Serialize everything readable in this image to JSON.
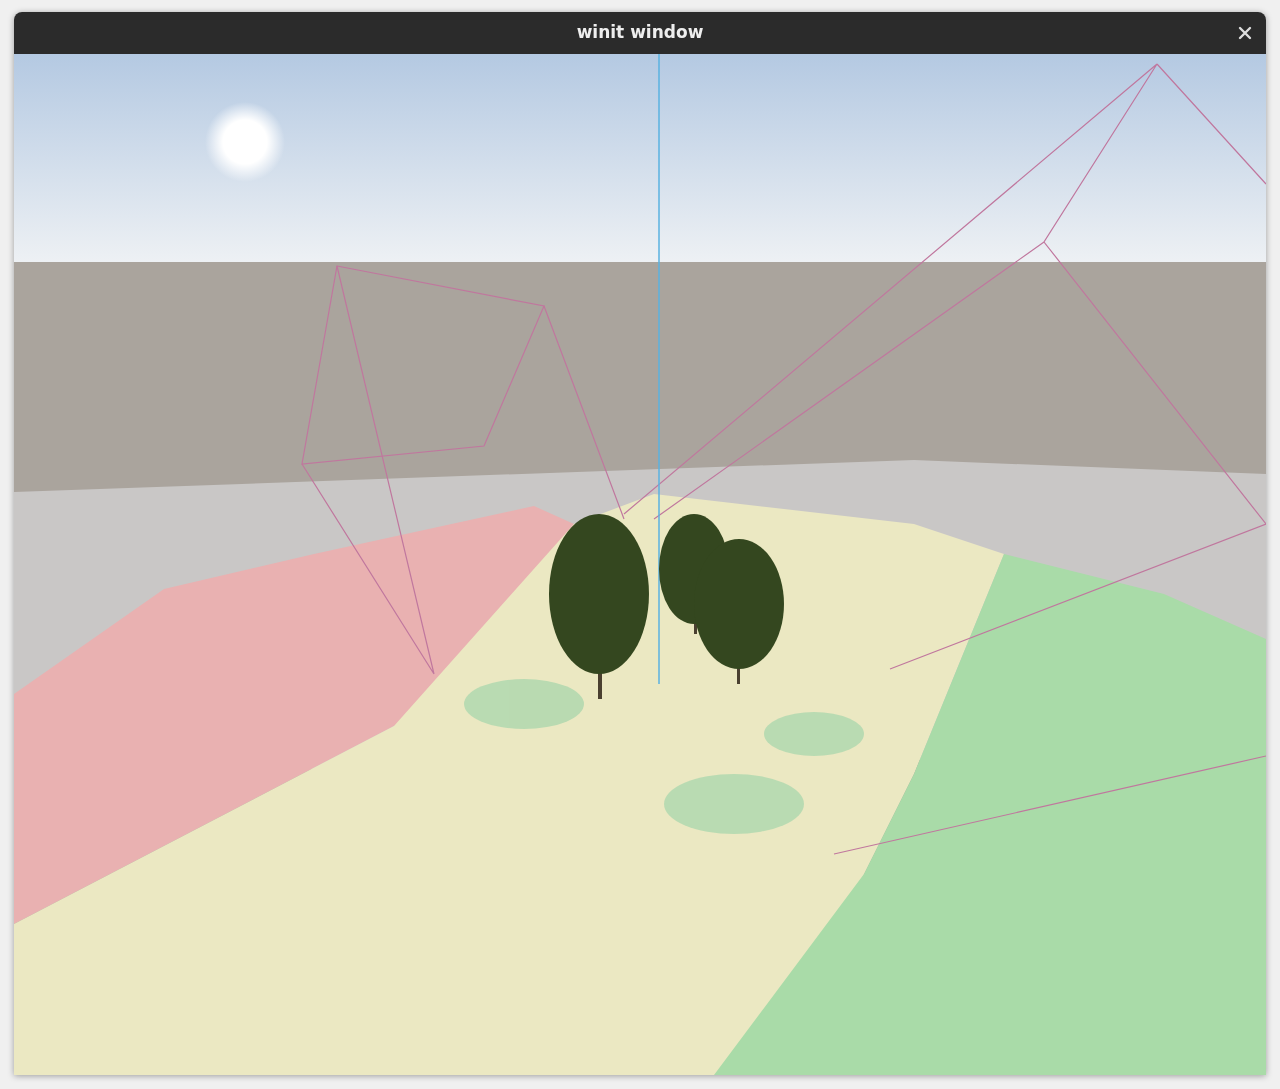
{
  "window": {
    "title": "winit window"
  }
}
